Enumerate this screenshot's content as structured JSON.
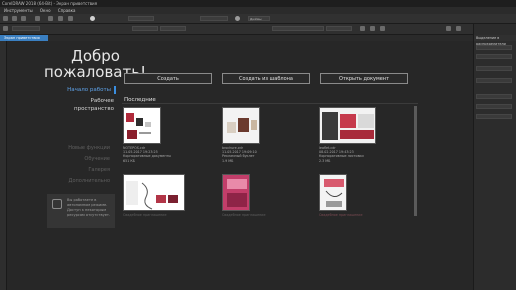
{
  "window": {
    "title": "CorelDRAW 2018 (64-Bit) - Экран приветствия"
  },
  "menu": [
    "Инструменты",
    "Окно",
    "Справка"
  ],
  "toolbar": {
    "zoom_value": "Дюймы"
  },
  "tab": {
    "label": "Экран приветствия"
  },
  "welcome": {
    "title_line1": "Добро",
    "title_line2": "пожаловать!"
  },
  "nav": {
    "get_started": "Начало работы",
    "workspace": "Рабочее пространство",
    "dim_items": [
      "Новые функции",
      "Обучение",
      "Галерея",
      "Дополнительно"
    ]
  },
  "notice": {
    "text": "Вы работаете в автономном режиме. Доступ к некоторым ресурсам отсутствует."
  },
  "actions": {
    "create": "Создать",
    "from_template": "Создать из шаблона",
    "open": "Открыть документ"
  },
  "recent": {
    "heading": "Последние",
    "items": [
      {
        "name": "NOTEPOS.cdr",
        "date": "11.05.2017 19:23:25",
        "type": "Корпоративные документы",
        "size": "651 КБ"
      },
      {
        "name": "brochure.cdr",
        "date": "11.05.2017 19:09:10",
        "type": "Рекламный буклет",
        "size": "1.9 МБ"
      },
      {
        "name": "leaflet.cdr",
        "date": "08.02.2017 19:43:23",
        "type": "Корпоративные листовки",
        "size": "2.3 МБ"
      },
      {
        "name": "Свадебное приглашение",
        "date": "",
        "type": "",
        "size": ""
      },
      {
        "name": "Свадебное приглашение",
        "date": "",
        "type": "",
        "size": ""
      },
      {
        "name": "Свадебное приглашение",
        "date": "",
        "type": "",
        "size": ""
      }
    ]
  },
  "right_panel": {
    "title": "Выделение в распределители"
  },
  "colors": {
    "accent": "#3a8ee0",
    "background": "#262626"
  }
}
